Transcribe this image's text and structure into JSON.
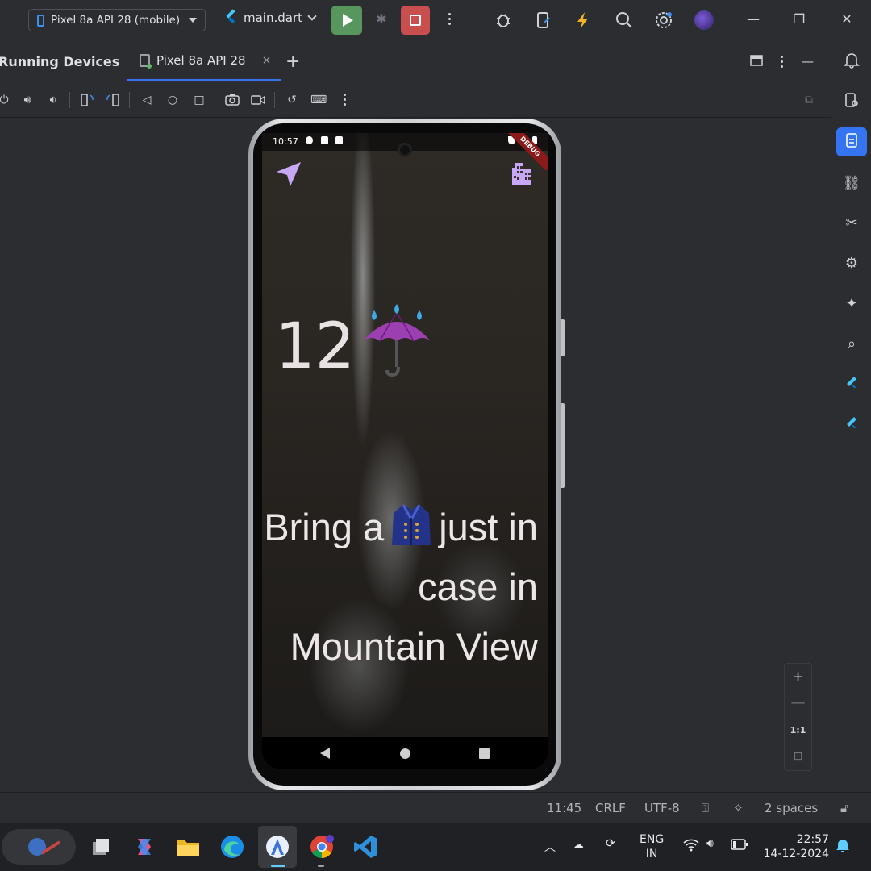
{
  "titlebar": {
    "device": "Pixel 8a API 28 (mobile)",
    "file": "main.dart"
  },
  "tool_window": {
    "title": "Running Devices",
    "tab_label": "Pixel 8a API 28",
    "tab_close": "×",
    "add_tab": "+"
  },
  "phone": {
    "status_time": "10:57",
    "debug_banner": "DEBUG",
    "temperature": "12",
    "weather_emoji": "umbrella-with-rain",
    "message_part1": "Bring a",
    "message_emoji": "coat",
    "message_part2": "just in case in Mountain View"
  },
  "zoom": {
    "plus": "+",
    "minus": "—",
    "actual": "1:1"
  },
  "ide_status": {
    "position": "11:45",
    "line_sep": "CRLF",
    "encoding": "UTF-8",
    "indent": "2 spaces"
  },
  "taskbar": {
    "lang_line1": "ENG",
    "lang_line2": "IN",
    "time": "22:57",
    "date": "14-12-2024"
  },
  "colors": {
    "accent": "#3574f0",
    "run": "#57965c",
    "stop": "#c94f4f",
    "nav_arrow": "#c6a8f7"
  }
}
